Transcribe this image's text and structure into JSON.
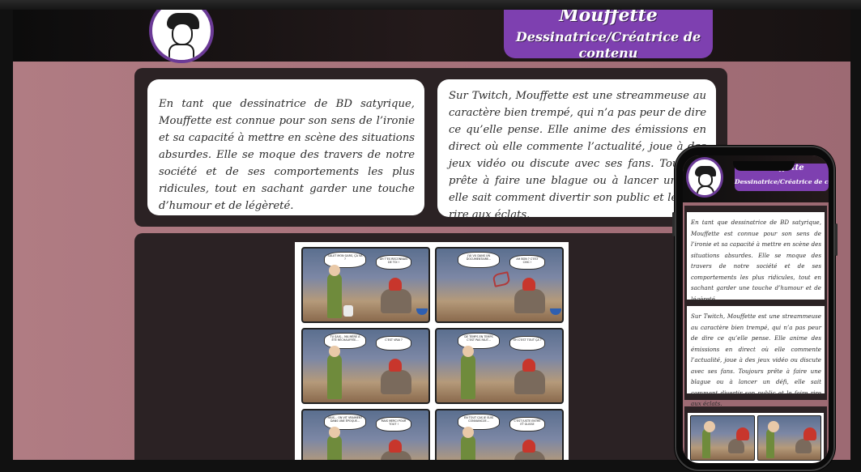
{
  "header": {
    "name": "Mouffette",
    "role": "Dessinatrice/Créatrice de contenu"
  },
  "cards": {
    "bio": "En tant que dessinatrice de BD satyrique, Mouffette est connue pour son sens de l’ironie et sa capacité à mettre en scène des situations absurdes. Elle se moque des travers de notre société et de ses comportements les plus ridicules, tout en sachant garder une touche d’humour et de légèreté.",
    "twitch": "Sur Twitch, Mouffette est une streammeuse au caractère bien trempé, qui n’a pas peur de dire ce qu’elle pense. Elle anime des émissions en direct où elle commente l’actualité, joue à des jeux vidéo ou discute avec ses fans. Toujours prête à faire une blague ou à lancer un défi, elle sait comment divertir son public et le faire rire aux éclats."
  },
  "comic": {
    "bubbles": [
      [
        "SALUT MON GARS, ÇA VA ?",
        "AH T’ES RECONNAIS DE TOI !"
      ],
      [
        "J’AI VU DANS UN DOCUMENTAIRE...",
        "AH BON ? C’EST CHIC !"
      ],
      [
        "TU SAIS... MA MÈRE A ÉTÉ RÉCHAUFFÉE...",
        "C’EST VRAI ?"
      ],
      [
        "DE TEMPS EN TEMPS C’EST PAS FAUT...",
        "OH C’EST TOUT ÇA ?"
      ],
      [
        "MAIS... ON VIT VRAIMENT DANS UNE ÉPOQUE...",
        "MAIS MERCI POUR TOUT !"
      ],
      [
        "EN TOUT CAS JE SUIS CONVAINCUE...",
        "C’EST JUSTE ENTRE ET GLISSE"
      ]
    ]
  },
  "colors": {
    "accent": "#7e40b0",
    "page_bg": "#a7727b",
    "panel_bg": "#2b2224",
    "header_bg": "#0c0c0c"
  },
  "icons": {
    "logo": "mouffette-avatar-icon"
  }
}
